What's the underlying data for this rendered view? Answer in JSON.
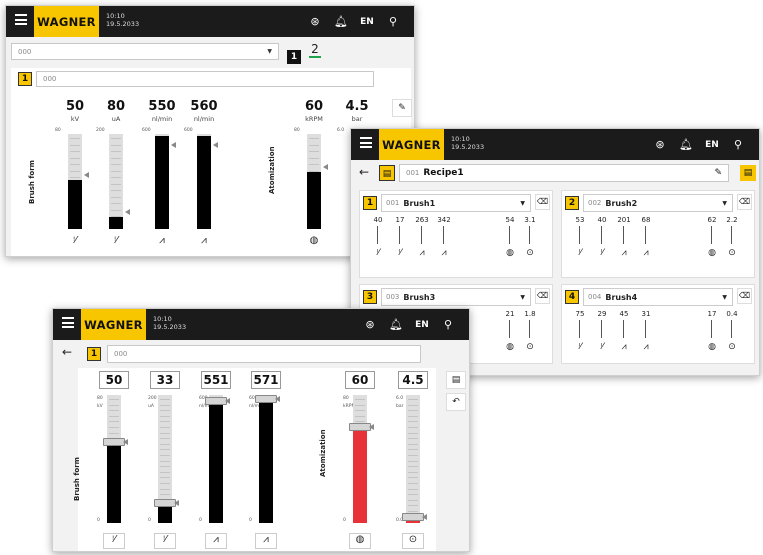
{
  "topbar": {
    "time": "10:10",
    "date": "19.5.2033",
    "logo": "WAGNER",
    "lang": "EN"
  },
  "win1": {
    "dropdown_value": "000",
    "page_tabs": [
      "1",
      "2"
    ],
    "row_number": "1",
    "row_value": "000",
    "group_left": "Brush form",
    "group_right": "Atomization",
    "gauges": [
      {
        "value": "50",
        "unit": "kV",
        "max": "80",
        "fill": 0.52,
        "icon": "gun-kv-icon"
      },
      {
        "value": "80",
        "unit": "uA",
        "max": "200",
        "fill": 0.13,
        "icon": "gun-ua-icon"
      },
      {
        "value": "550",
        "unit": "nl/min",
        "max": "600",
        "fill": 0.98,
        "icon": "air-flow-icon"
      },
      {
        "value": "560",
        "unit": "nl/min",
        "max": "600",
        "fill": 0.98,
        "icon": "air-flow-icon"
      },
      {
        "value": "60",
        "unit": "kRPM",
        "max": "80",
        "fill": 0.6,
        "icon": "turbine-icon"
      },
      {
        "value": "4.5",
        "unit": "bar",
        "max": "6.0",
        "fill": 0.0,
        "icon": "pressure-icon"
      }
    ]
  },
  "win2": {
    "recipe_number": "001",
    "recipe_name": "Recipe1",
    "brushes": [
      {
        "index": "1",
        "number": "001",
        "name": "Brush1",
        "values": [
          "40",
          "17",
          "263",
          "342",
          "54",
          "3.1"
        ]
      },
      {
        "index": "2",
        "number": "002",
        "name": "Brush2",
        "values": [
          "53",
          "40",
          "201",
          "68",
          "62",
          "2.2"
        ]
      },
      {
        "index": "3",
        "number": "003",
        "name": "Brush3",
        "values": [
          "21",
          "1.8"
        ]
      },
      {
        "index": "4",
        "number": "004",
        "name": "Brush4",
        "values": [
          "75",
          "29",
          "45",
          "31",
          "17",
          "0.4"
        ]
      }
    ]
  },
  "win3": {
    "row_number": "1",
    "row_value": "000",
    "group_left": "Brush form",
    "group_right": "Atomization",
    "sliders": [
      {
        "value": "50",
        "top": "80",
        "unit": "kV",
        "bottom": "0",
        "fill": 0.63,
        "icon": "gun-kv-icon"
      },
      {
        "value": "33",
        "top": "200",
        "unit": "uA",
        "bottom": "0",
        "fill": 0.16,
        "icon": "gun-ua-icon"
      },
      {
        "value": "551",
        "top": "600",
        "unit": "nl/min",
        "bottom": "0",
        "fill": 0.95,
        "icon": "air-flow-icon"
      },
      {
        "value": "571",
        "top": "600",
        "unit": "nl/min",
        "bottom": "0",
        "fill": 0.97,
        "icon": "air-flow-icon"
      },
      {
        "value": "60",
        "top": "80",
        "unit": "kRPM",
        "bottom": "0",
        "fill": 0.75,
        "icon": "turbine-icon"
      },
      {
        "value": "4.5",
        "top": "6.0",
        "unit": "bar",
        "bottom": "0.0",
        "fill": 0.05,
        "icon": "pressure-icon"
      }
    ],
    "colors": {
      "atomization_fill": "#e8323a",
      "bar_fill": "#000000",
      "accent": "#f7c600"
    }
  }
}
